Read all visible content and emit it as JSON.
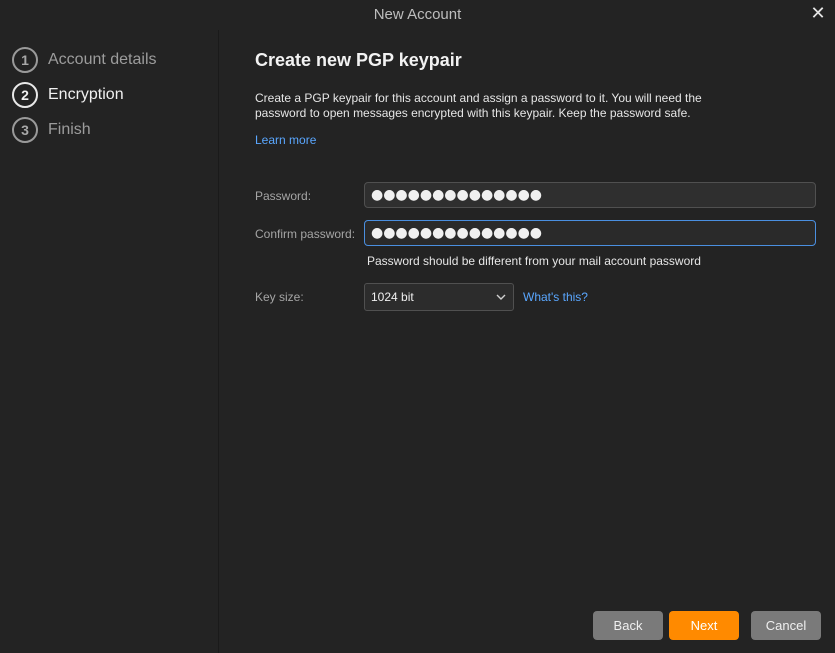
{
  "window": {
    "title": "New Account",
    "close_glyph": "✕"
  },
  "steps": [
    {
      "number": "1",
      "label": "Account details",
      "active": false
    },
    {
      "number": "2",
      "label": "Encryption",
      "active": true
    },
    {
      "number": "3",
      "label": "Finish",
      "active": false
    }
  ],
  "main": {
    "heading": "Create new PGP keypair",
    "description": "Create a PGP keypair for this account and assign a password to it. You will need the password to open messages encrypted with this keypair. Keep the password safe.",
    "learn_more": "Learn more"
  },
  "form": {
    "password_label": "Password:",
    "password_value": "●●●●●●●●●●●●●●",
    "confirm_label": "Confirm password:",
    "confirm_value": "●●●●●●●●●●●●●●",
    "hint": "Password should be different from your mail account password",
    "keysize_label": "Key size:",
    "keysize_value": "1024 bit",
    "whats_this": "What's this?"
  },
  "buttons": {
    "back": "Back",
    "next": "Next",
    "cancel": "Cancel"
  },
  "colors": {
    "accent": "#ff8a00",
    "link": "#5aa7ff",
    "focus": "#4a8fe0"
  },
  "icons": {
    "close": "close-icon",
    "dropdown": "chevron-down-icon"
  }
}
